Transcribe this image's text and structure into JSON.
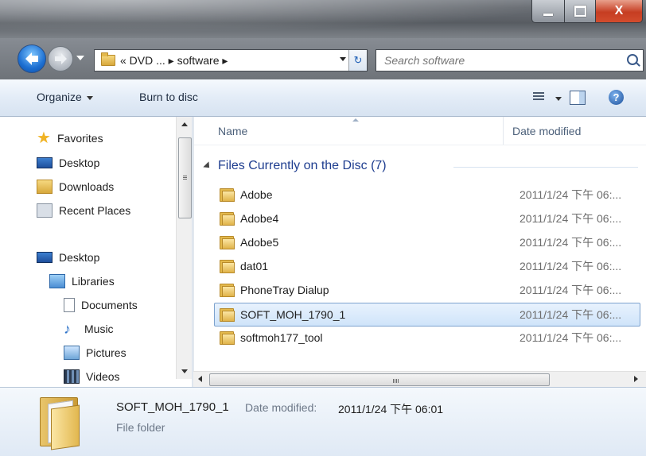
{
  "titlebar": {
    "minimize_label": "–",
    "maximize_label": "",
    "close_label": "X"
  },
  "address": {
    "breadcrumb": "« DVD ... ▸ software ▸",
    "refresh_icon": "↻"
  },
  "search": {
    "placeholder": "Search software"
  },
  "toolbar": {
    "organize_label": "Organize",
    "burn_label": "Burn to disc",
    "help_label": "?"
  },
  "navpane": {
    "favorites": [
      {
        "label": "Favorites",
        "icon": "star-icon"
      },
      {
        "label": "Desktop",
        "icon": "desktop-icon"
      },
      {
        "label": "Downloads",
        "icon": "downloads-icon"
      },
      {
        "label": "Recent Places",
        "icon": "recent-places-icon"
      }
    ],
    "desktop_tree": [
      {
        "label": "Desktop",
        "icon": "desktop-icon"
      },
      {
        "label": "Libraries",
        "icon": "libraries-icon"
      },
      {
        "label": "Documents",
        "icon": "documents-icon"
      },
      {
        "label": "Music",
        "icon": "music-icon"
      },
      {
        "label": "Pictures",
        "icon": "pictures-icon"
      },
      {
        "label": "Videos",
        "icon": "videos-icon"
      }
    ]
  },
  "columns": {
    "name": "Name",
    "date": "Date modified"
  },
  "group": {
    "label": "Files Currently on the Disc (7)"
  },
  "files": [
    {
      "name": "Adobe",
      "date": "2011/1/24 下午 06:...",
      "selected": false
    },
    {
      "name": "Adobe4",
      "date": "2011/1/24 下午 06:...",
      "selected": false
    },
    {
      "name": "Adobe5",
      "date": "2011/1/24 下午 06:...",
      "selected": false
    },
    {
      "name": "dat01",
      "date": "2011/1/24 下午 06:...",
      "selected": false
    },
    {
      "name": "PhoneTray Dialup",
      "date": "2011/1/24 下午 06:...",
      "selected": false
    },
    {
      "name": "SOFT_MOH_1790_1",
      "date": "2011/1/24 下午 06:...",
      "selected": true
    },
    {
      "name": "softmoh177_tool",
      "date": "2011/1/24 下午 06:...",
      "selected": false
    }
  ],
  "hscroll": {
    "grip": "III"
  },
  "details": {
    "name": "SOFT_MOH_1790_1",
    "date_label": "Date modified:",
    "date_value": "2011/1/24 下午 06:01",
    "type": "File folder"
  },
  "colors": {
    "selection_bg": "#cfe4fa",
    "selection_border": "#7da2ce",
    "group_header": "#1e3d8f",
    "toolbar_bg": "#e3ecf7"
  }
}
